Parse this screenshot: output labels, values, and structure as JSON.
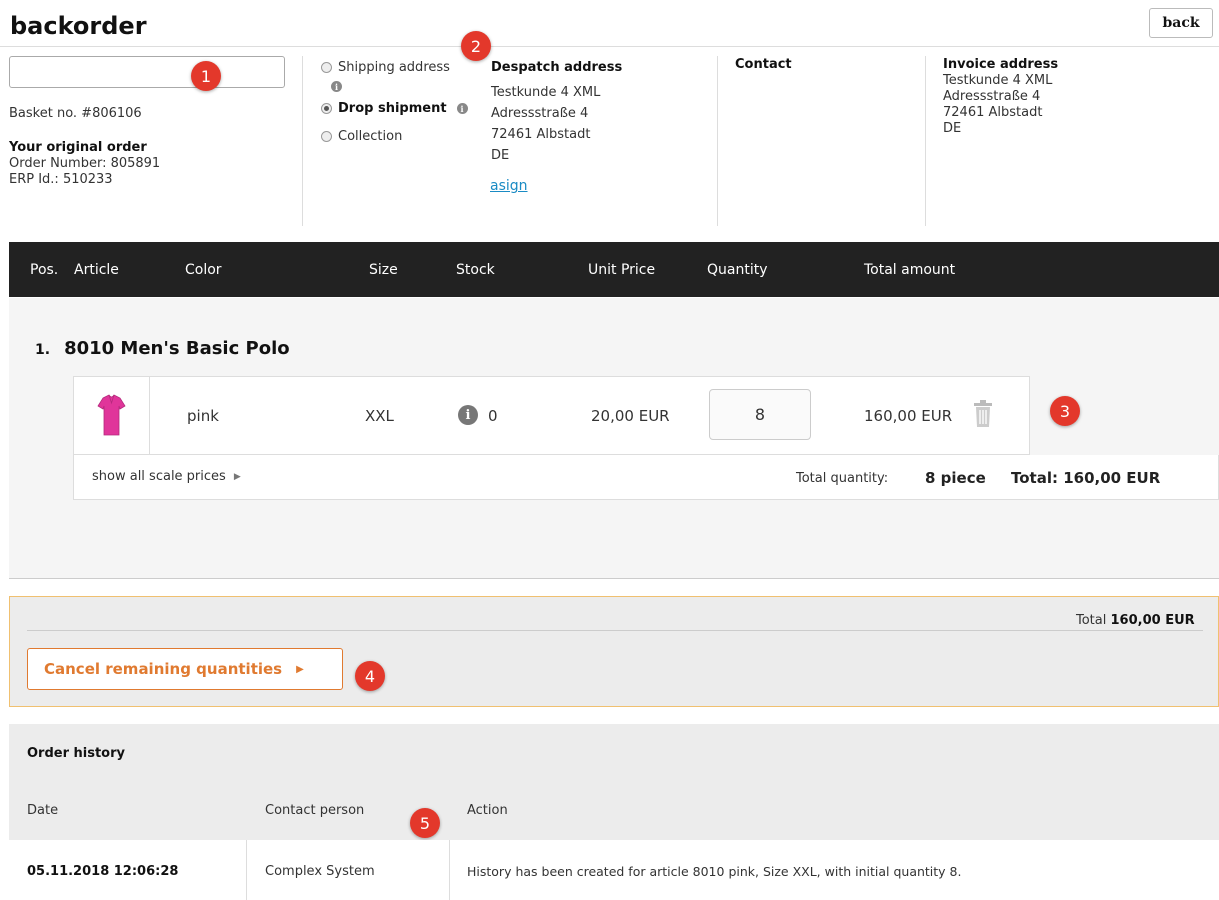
{
  "header": {
    "title": "backorder",
    "back_label": "back"
  },
  "basket": {
    "input_value": "",
    "basket_no": "Basket no. #806106",
    "original_order_label": "Your original order",
    "order_number": "Order Number: 805891",
    "erp_id": "ERP Id.: 510233"
  },
  "shipping": {
    "options": [
      {
        "label": "Shipping address",
        "selected": false
      },
      {
        "label": "Drop shipment",
        "selected": true
      },
      {
        "label": "Collection",
        "selected": false
      }
    ]
  },
  "despatch": {
    "title": "Despatch address",
    "lines": [
      "Testkunde 4 XML",
      "Adressstraße 4",
      "72461 Albstadt",
      "DE"
    ],
    "assign_link": "asign"
  },
  "contact": {
    "title": "Contact"
  },
  "invoice": {
    "title": "Invoice address",
    "lines": [
      "Testkunde 4 XML",
      "Adressstraße 4",
      "72461 Albstadt",
      "DE"
    ]
  },
  "table": {
    "columns": [
      "Pos.",
      "Article",
      "Color",
      "Size",
      "Stock",
      "Unit Price",
      "Quantity",
      "Total amount"
    ]
  },
  "product": {
    "pos": "1.",
    "name": "8010 Men's Basic Polo",
    "color": "pink",
    "size": "XXL",
    "stock": "0",
    "unit_price": "20,00 EUR",
    "quantity": "8",
    "total_amount": "160,00 EUR",
    "scale_prices_label": "show all scale prices",
    "total_quantity_label": "Total quantity:",
    "total_quantity_value": "8 piece",
    "total_label": "Total: 160,00 EUR"
  },
  "summary": {
    "total_prefix": "Total",
    "total_value": "160,00 EUR",
    "cancel_label": "Cancel remaining quantities"
  },
  "history": {
    "title": "Order history",
    "columns": [
      "Date",
      "Contact person",
      "Action"
    ],
    "rows": [
      {
        "date": "05.11.2018 12:06:28",
        "contact": "Complex System",
        "action": "History has been created for article 8010 pink, Size XXL, with initial quantity 8."
      }
    ]
  },
  "markers": [
    "1",
    "2",
    "3",
    "4",
    "5"
  ],
  "colors": {
    "accent_orange": "#e07a30",
    "marker_red": "#e3382b",
    "header_dark": "#222222",
    "link_blue": "#1a8bc4",
    "shirt_pink": "#e0359a"
  },
  "icons": {
    "info": "info-icon",
    "trash": "trash-icon",
    "arrow": "triangle-right-icon"
  }
}
